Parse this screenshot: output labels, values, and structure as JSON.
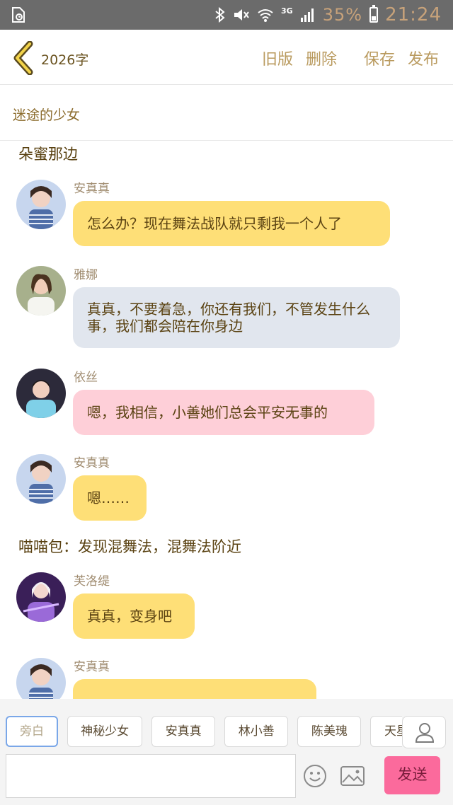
{
  "status_bar": {
    "signal_type": "3G",
    "battery": "35%",
    "time": "21:24",
    "icons": [
      "sim-icon",
      "bluetooth-icon",
      "mute-icon",
      "wifi-icon",
      "signal-icon",
      "battery-icon"
    ],
    "battery_level": 0.35
  },
  "header": {
    "word_count": "2026字",
    "actions": {
      "old_version": "旧版",
      "delete": "删除",
      "save": "保存",
      "publish": "发布"
    }
  },
  "story_title": "迷途的少女",
  "messages": [
    {
      "type": "narration",
      "text": "朵蜜那边"
    },
    {
      "type": "chat",
      "sender": "安真真",
      "text": "怎么办？现在舞法战队就只剩我一个人了",
      "color": "yellow"
    },
    {
      "type": "chat",
      "sender": "雅娜",
      "text": "真真，不要着急，你还有我们，不管发生什么事，我们都会陪在你身边",
      "color": "gray"
    },
    {
      "type": "chat",
      "sender": "依丝",
      "text": "嗯，我相信，小善她们总会平安无事的",
      "color": "pink"
    },
    {
      "type": "chat",
      "sender": "安真真",
      "text": "嗯……",
      "color": "yellow"
    },
    {
      "type": "narration",
      "text": "喵喵包：发现混舞法，混舞法阶近"
    },
    {
      "type": "chat",
      "sender": "芙洛缇",
      "text": "真真，变身吧",
      "color": "yellow"
    },
    {
      "type": "chat",
      "sender": "安真真",
      "text": "",
      "color": "yellow"
    }
  ],
  "characters": [
    "旁白",
    "神秘少女",
    "安真真",
    "林小善",
    "陈美瑰",
    "天星羽"
  ],
  "selected_character": "旁白",
  "input": {
    "value": "",
    "placeholder": ""
  },
  "send_label": "发送",
  "colors": {
    "bubble_yellow": "#fedf77",
    "bubble_gray": "#e1e6ee",
    "bubble_pink": "#fecfd8",
    "send_button": "#fb6a9c",
    "accent_gold": "#b99a5e"
  }
}
